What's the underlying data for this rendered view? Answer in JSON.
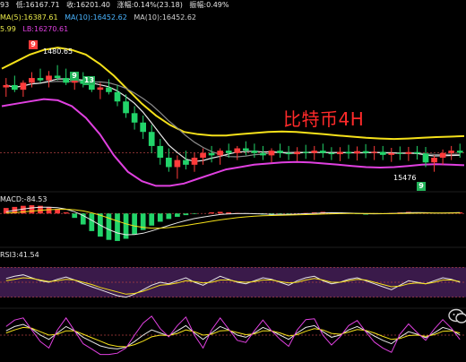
{
  "header": {
    "row1": [
      "93",
      "低:16167.71",
      "收:16201.40",
      "涨幅:0.14%(23.18)",
      "振幅:0.49%"
    ],
    "row2": [
      {
        "text": "MA(5):16387.61",
        "color": "#e8e84a"
      },
      {
        "text": "MA(10):16452.62",
        "color": "#4ab4ff"
      },
      {
        "text": "MA(10):16452.62",
        "color": "#d0d0d0"
      }
    ],
    "row3": [
      {
        "text": "5.99",
        "color": "#e8e84a"
      },
      {
        "text": "LB:16270.61",
        "color": "#e040e0"
      }
    ]
  },
  "title_overlay": "比特币4H",
  "annotations": {
    "high_label": "1480.65",
    "low_label": "15476",
    "badge_top": "9",
    "badge_left1": "9",
    "badge_left2": "13",
    "badge_bottom": "9"
  },
  "macd_header": "MACD:-84.53",
  "rsi_header": "RSI3:41.54",
  "colors": {
    "up": "#ff3b3b",
    "down": "#22d46a",
    "boll_upper": "#f5e11a",
    "boll_lower": "#e040e0",
    "ma_white": "#e8e8e8",
    "ma_gray": "#8a8a8a",
    "grid": "#b04040",
    "rsi_band": "#3a1a4a"
  },
  "chart_data": [
    {
      "type": "candlestick",
      "title": "比特币4H",
      "ohlc": [
        [
          16480,
          16520,
          16440,
          16490
        ],
        [
          16490,
          16530,
          16460,
          16470
        ],
        [
          16470,
          16510,
          16440,
          16500
        ],
        [
          16500,
          16545,
          16480,
          16520
        ],
        [
          16520,
          16560,
          16500,
          16510
        ],
        [
          16510,
          16550,
          16480,
          16530
        ],
        [
          16530,
          16575,
          16510,
          16520
        ],
        [
          16520,
          16560,
          16490,
          16500
        ],
        [
          16500,
          16540,
          16470,
          16510
        ],
        [
          16510,
          16545,
          16480,
          16495
        ],
        [
          16495,
          16520,
          16460,
          16470
        ],
        [
          16470,
          16500,
          16430,
          16480
        ],
        [
          16480,
          16515,
          16450,
          16460
        ],
        [
          16460,
          16490,
          16400,
          16420
        ],
        [
          16420,
          16450,
          16350,
          16370
        ],
        [
          16370,
          16400,
          16300,
          16330
        ],
        [
          16330,
          16360,
          16260,
          16290
        ],
        [
          16290,
          16320,
          16200,
          16230
        ],
        [
          16230,
          16260,
          16150,
          16180
        ],
        [
          16180,
          16220,
          16120,
          16140
        ],
        [
          16140,
          16190,
          16090,
          16170
        ],
        [
          16170,
          16210,
          16130,
          16150
        ],
        [
          16150,
          16200,
          16120,
          16180
        ],
        [
          16180,
          16220,
          16150,
          16200
        ],
        [
          16200,
          16230,
          16160,
          16190
        ],
        [
          16190,
          16220,
          16150,
          16210
        ],
        [
          16210,
          16240,
          16180,
          16200
        ],
        [
          16200,
          16230,
          16170,
          16220
        ],
        [
          16220,
          16250,
          16190,
          16210
        ],
        [
          16210,
          16240,
          16180,
          16200
        ],
        [
          16200,
          16230,
          16170,
          16190
        ],
        [
          16190,
          16220,
          16160,
          16210
        ],
        [
          16210,
          16240,
          16180,
          16200
        ],
        [
          16200,
          16230,
          16170,
          16195
        ],
        [
          16195,
          16225,
          16165,
          16205
        ],
        [
          16205,
          16235,
          16175,
          16200
        ],
        [
          16200,
          16230,
          16170,
          16210
        ],
        [
          16210,
          16240,
          16180,
          16200
        ],
        [
          16200,
          16225,
          16170,
          16195
        ],
        [
          16195,
          16225,
          16165,
          16205
        ],
        [
          16205,
          16235,
          16175,
          16198
        ],
        [
          16198,
          16228,
          16168,
          16208
        ],
        [
          16208,
          16238,
          16178,
          16200
        ],
        [
          16200,
          16230,
          16170,
          16205
        ],
        [
          16205,
          16230,
          16170,
          16192
        ],
        [
          16192,
          16222,
          16162,
          16200
        ],
        [
          16200,
          16228,
          16170,
          16196
        ],
        [
          16196,
          16226,
          16166,
          16204
        ],
        [
          16204,
          16230,
          16172,
          16198
        ],
        [
          16198,
          16226,
          16140,
          16160
        ],
        [
          16160,
          16190,
          16120,
          16180
        ],
        [
          16180,
          16215,
          16150,
          16200
        ],
        [
          16200,
          16230,
          16170,
          16210
        ],
        [
          16210,
          16240,
          16180,
          16201
        ]
      ],
      "boll_upper": [
        16560,
        16590,
        16620,
        16640,
        16650,
        16640,
        16620,
        16580,
        16530,
        16470,
        16410,
        16360,
        16320,
        16290,
        16280,
        16275,
        16275,
        16280,
        16285,
        16290,
        16292,
        16290,
        16285,
        16280,
        16275,
        16270,
        16265,
        16262,
        16260,
        16262,
        16265,
        16268,
        16270,
        16272
      ],
      "boll_lower": [
        16400,
        16410,
        16420,
        16430,
        16425,
        16400,
        16350,
        16280,
        16190,
        16120,
        16080,
        16060,
        16060,
        16070,
        16090,
        16110,
        16130,
        16140,
        16150,
        16155,
        16160,
        16162,
        16160,
        16155,
        16150,
        16145,
        16140,
        16138,
        16140,
        16145,
        16150,
        16152,
        16150,
        16148
      ],
      "ylim": [
        16050,
        16700
      ]
    },
    {
      "type": "bar",
      "title": "MACD",
      "values": [
        10,
        12,
        14,
        15,
        14,
        12,
        8,
        2,
        -8,
        -20,
        -32,
        -42,
        -48,
        -50,
        -46,
        -38,
        -30,
        -22,
        -15,
        -10,
        -6,
        -3,
        -1,
        0,
        2,
        3,
        2,
        1,
        0,
        -1,
        -2,
        -3,
        -2,
        -1,
        0,
        1,
        2,
        3,
        2,
        1,
        0,
        -1,
        -2,
        -1,
        0,
        1,
        2,
        3,
        2,
        1,
        0,
        1,
        2,
        2
      ],
      "ylim": [
        -55,
        20
      ]
    },
    {
      "type": "line",
      "title": "RSI",
      "series": [
        {
          "values": [
            55,
            58,
            60,
            56,
            52,
            50,
            54,
            57,
            53,
            48,
            44,
            40,
            36,
            32,
            30,
            34,
            40,
            46,
            50,
            48,
            52,
            56,
            50,
            46,
            52,
            58,
            54,
            50,
            48,
            52,
            56,
            54,
            50,
            46,
            52,
            56,
            58,
            52,
            48,
            50,
            54,
            56,
            52,
            48,
            44,
            40,
            46,
            52,
            50,
            48,
            52,
            56,
            54,
            50
          ]
        },
        {
          "values": [
            52,
            54,
            56,
            55,
            53,
            51,
            52,
            54,
            53,
            50,
            47,
            43,
            40,
            37,
            34,
            35,
            38,
            42,
            46,
            47,
            49,
            52,
            51,
            49,
            50,
            53,
            53,
            51,
            50,
            51,
            53,
            53,
            51,
            49,
            50,
            53,
            55,
            53,
            50,
            50,
            52,
            54,
            53,
            50,
            47,
            44,
            45,
            48,
            49,
            48,
            50,
            53,
            53,
            51
          ]
        }
      ],
      "ylim": [
        20,
        80
      ]
    },
    {
      "type": "line",
      "title": "KDJ",
      "series": [
        {
          "values": [
            60,
            70,
            75,
            65,
            50,
            40,
            55,
            70,
            60,
            45,
            35,
            25,
            20,
            18,
            22,
            35,
            50,
            62,
            55,
            48,
            60,
            72,
            55,
            40,
            55,
            70,
            62,
            50,
            45,
            55,
            68,
            60,
            50,
            40,
            55,
            68,
            72,
            58,
            45,
            50,
            62,
            70,
            60,
            48,
            38,
            30,
            45,
            58,
            52,
            44,
            55,
            68,
            62,
            50
          ]
        },
        {
          "values": [
            55,
            62,
            68,
            66,
            58,
            50,
            52,
            60,
            60,
            52,
            44,
            36,
            28,
            24,
            23,
            28,
            36,
            46,
            50,
            49,
            54,
            62,
            58,
            50,
            52,
            60,
            61,
            56,
            51,
            53,
            60,
            60,
            55,
            48,
            51,
            59,
            65,
            62,
            54,
            52,
            57,
            63,
            61,
            55,
            47,
            40,
            42,
            49,
            50,
            47,
            51,
            59,
            60,
            55
          ]
        },
        {
          "values": [
            70,
            85,
            90,
            62,
            35,
            20,
            62,
            90,
            60,
            30,
            18,
            5,
            5,
            8,
            20,
            50,
            78,
            94,
            65,
            46,
            72,
            92,
            50,
            20,
            62,
            90,
            64,
            38,
            33,
            60,
            85,
            60,
            40,
            24,
            62,
            86,
            88,
            50,
            27,
            46,
            72,
            84,
            58,
            34,
            20,
            10,
            52,
            76,
            56,
            38,
            64,
            86,
            66,
            40
          ]
        }
      ],
      "ylim": [
        0,
        100
      ]
    }
  ]
}
